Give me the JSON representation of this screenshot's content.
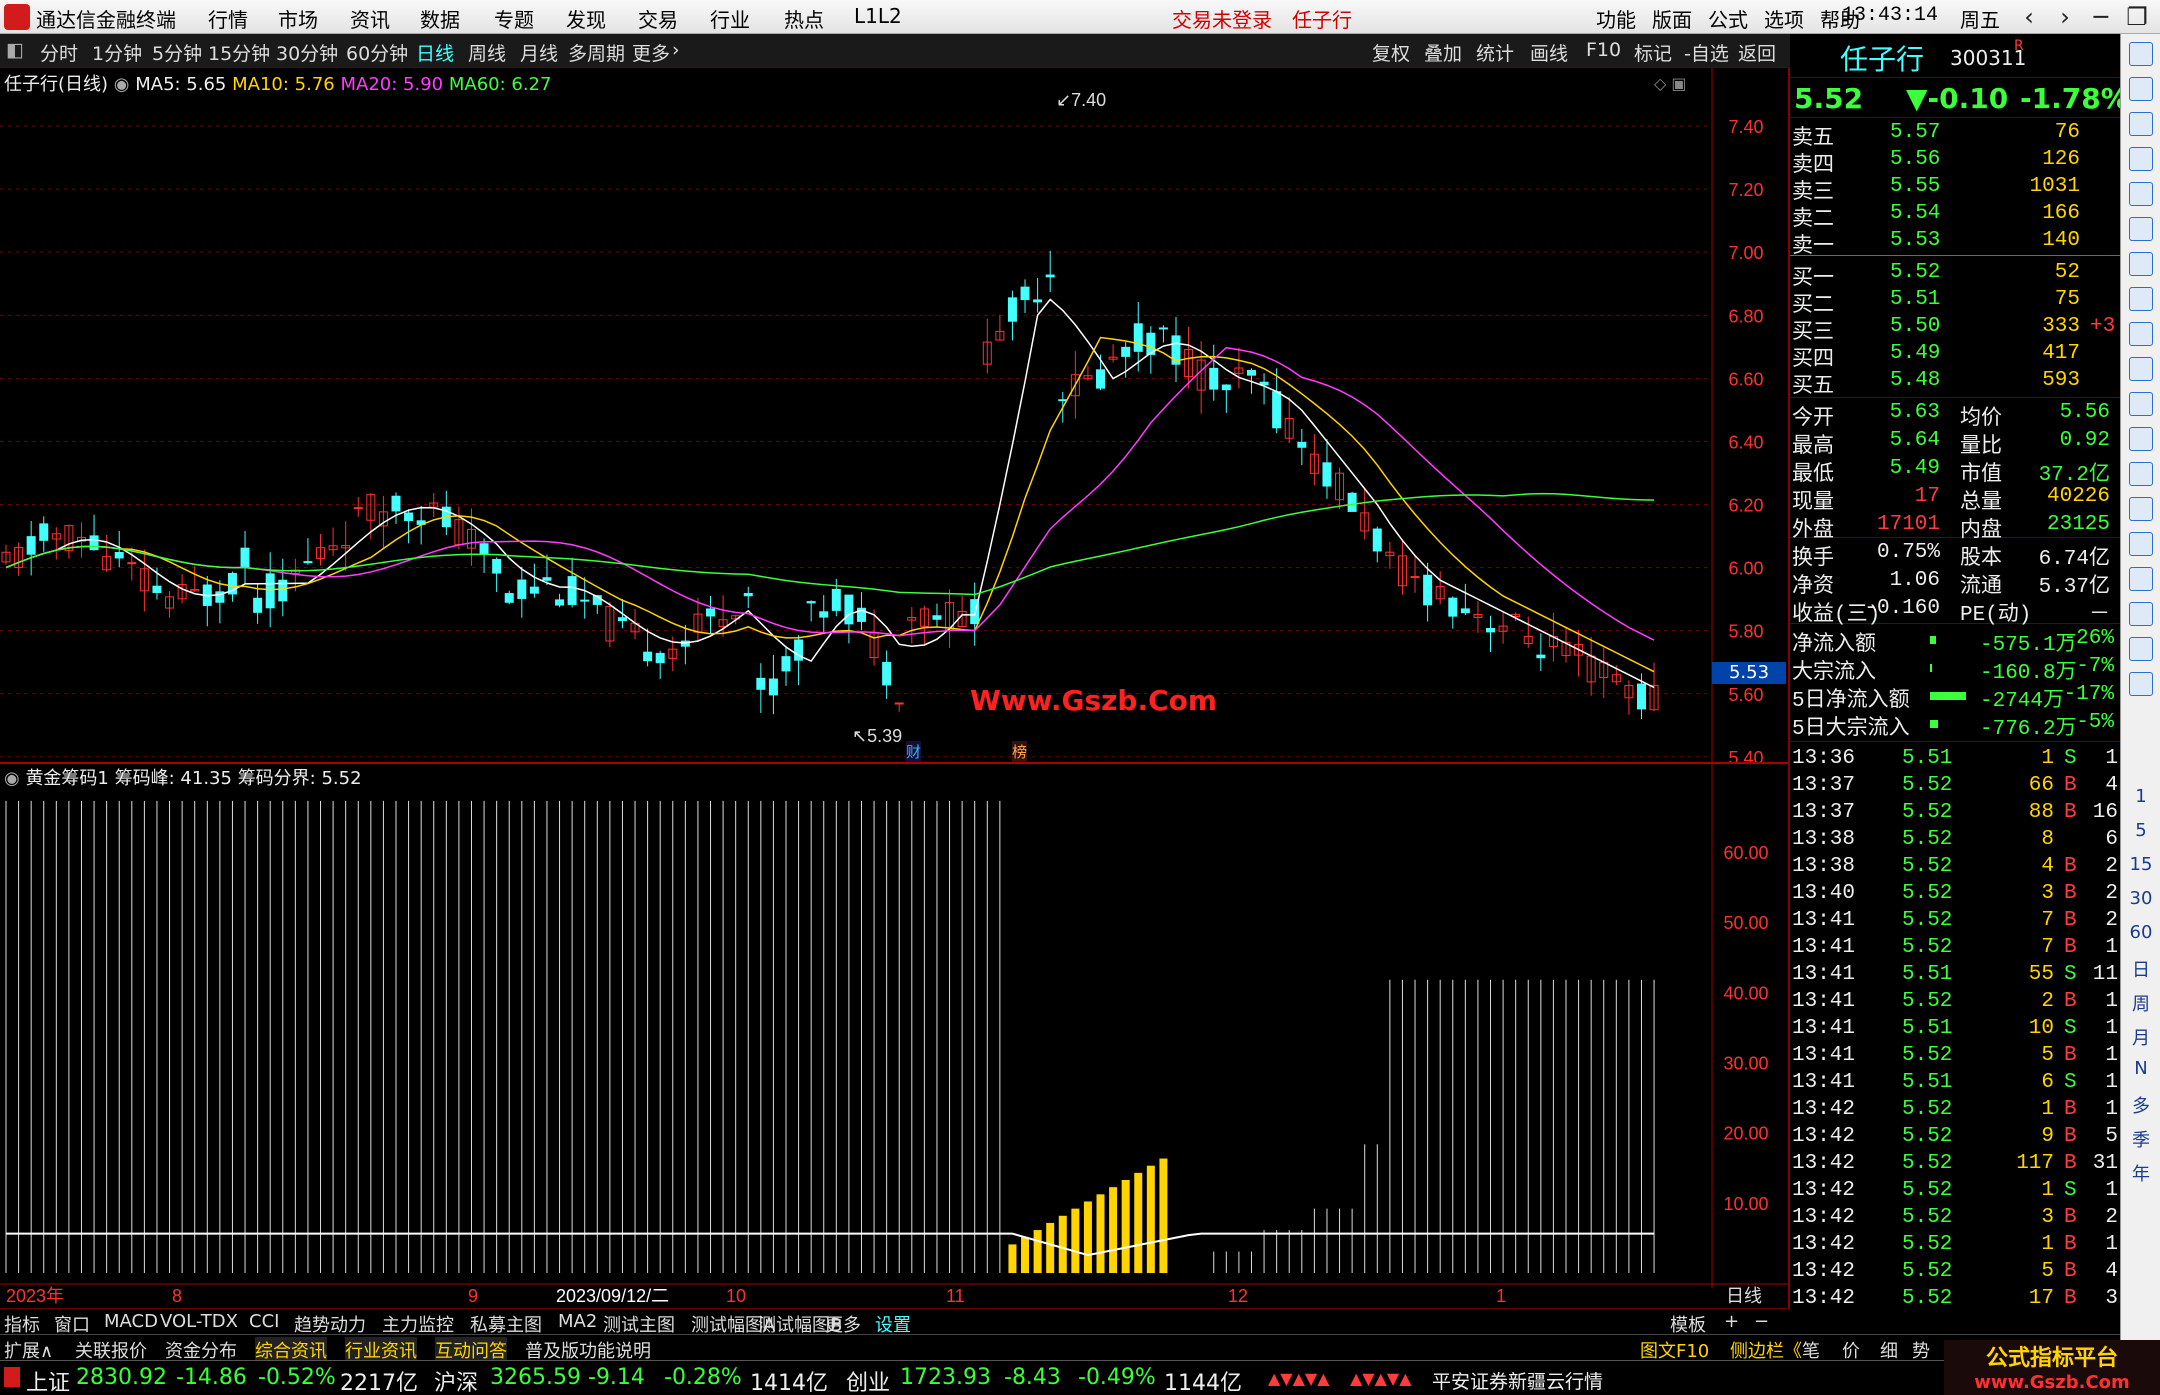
{
  "titlebar": {
    "app": "通达信金融终端",
    "menus": [
      "行情",
      "市场",
      "资讯",
      "数据",
      "专题",
      "发现",
      "交易",
      "行业",
      "热点",
      "L1L2"
    ],
    "login": "交易未登录",
    "stock": "任子行",
    "right_menus": [
      "功能",
      "版面",
      "公式",
      "选项",
      "帮助"
    ],
    "time": "13:43:14",
    "weekday": "周五",
    "controls": [
      "‹",
      "›",
      "─",
      "❐",
      "✕"
    ]
  },
  "periodbar": {
    "items": [
      "分时",
      "1分钟",
      "5分钟",
      "15分钟",
      "30分钟",
      "60分钟",
      "日线",
      "周线",
      "月线",
      "多周期",
      "更多"
    ],
    "active": "日线",
    "tools": [
      "复权",
      "叠加",
      "统计",
      "画线",
      "F10",
      "标记",
      "-自选",
      "返回"
    ]
  },
  "main_chart": {
    "title": "任子行(日线)",
    "ma5": "MA5: 5.65",
    "ma10": "MA10: 5.76",
    "ma20": "MA20: 5.90",
    "ma60": "MA60: 6.27",
    "high_label": "7.40",
    "low_label": "5.39",
    "current_price": "5.53",
    "marker_cai": "财",
    "marker_bang": "榜",
    "watermark": "Www.Gszb.Com",
    "price_ticks": [
      "7.40",
      "7.20",
      "7.00",
      "6.80",
      "6.60",
      "6.40",
      "6.20",
      "6.00",
      "5.80",
      "5.60",
      "5.40"
    ]
  },
  "sub_chart": {
    "title": "黄金筹码1",
    "peak": "筹码峰: 41.35",
    "boundary": "筹码分界: 5.52",
    "ticks": [
      "60.00",
      "50.00",
      "40.00",
      "30.00",
      "20.00",
      "10.00"
    ]
  },
  "xaxis": {
    "labels": [
      "2023年",
      "8",
      "9",
      "2023/09/12/二",
      "10",
      "11",
      "12",
      "1"
    ],
    "right": "日线"
  },
  "chart_data": {
    "type": "candlestick",
    "series": [
      {
        "name": "MA5",
        "value": 5.65
      },
      {
        "name": "MA10",
        "value": 5.76
      },
      {
        "name": "MA20",
        "value": 5.9
      },
      {
        "name": "MA60",
        "value": 6.27
      }
    ],
    "ylim": [
      5.35,
      7.45
    ],
    "high": 7.4,
    "low": 5.39,
    "last": 5.53
  },
  "quote": {
    "name": "任子行",
    "code": "300311",
    "flag": "R",
    "price": "5.52",
    "change": "▼-0.10",
    "pct": "-1.78%",
    "asks": [
      {
        "l": "卖五",
        "p": "5.57",
        "v": "76"
      },
      {
        "l": "卖四",
        "p": "5.56",
        "v": "126"
      },
      {
        "l": "卖三",
        "p": "5.55",
        "v": "1031"
      },
      {
        "l": "卖二",
        "p": "5.54",
        "v": "166"
      },
      {
        "l": "卖一",
        "p": "5.53",
        "v": "140"
      }
    ],
    "bids": [
      {
        "l": "买一",
        "p": "5.52",
        "v": "52",
        "x": ""
      },
      {
        "l": "买二",
        "p": "5.51",
        "v": "75",
        "x": ""
      },
      {
        "l": "买三",
        "p": "5.50",
        "v": "333",
        "x": "+3"
      },
      {
        "l": "买四",
        "p": "5.49",
        "v": "417",
        "x": ""
      },
      {
        "l": "买五",
        "p": "5.48",
        "v": "593",
        "x": ""
      }
    ],
    "stats": [
      {
        "a": "今开",
        "b": "5.63",
        "c": "均价",
        "d": "5.56"
      },
      {
        "a": "最高",
        "b": "5.64",
        "c": "量比",
        "d": "0.92"
      },
      {
        "a": "最低",
        "b": "5.49",
        "c": "市值",
        "d": "37.2亿"
      },
      {
        "a": "现量",
        "b": "17",
        "c": "总量",
        "d": "40226"
      },
      {
        "a": "外盘",
        "b": "17101",
        "c": "内盘",
        "d": "23125"
      }
    ],
    "stats2": [
      {
        "a": "换手",
        "b": "0.75%",
        "c": "股本",
        "d": "6.74亿"
      },
      {
        "a": "净资",
        "b": "1.06",
        "c": "流通",
        "d": "5.37亿"
      },
      {
        "a": "收益(三)",
        "b": "-0.160",
        "c": "PE(动)",
        "d": "－"
      }
    ],
    "flows": [
      {
        "a": "净流入额",
        "b": "-575.1万",
        "c": "-26%"
      },
      {
        "a": "大宗流入",
        "b": "-160.8万",
        "c": "-7%"
      },
      {
        "a": "5日净流入额",
        "b": "-2744万",
        "c": "-17%"
      },
      {
        "a": "5日大宗流入",
        "b": "-776.2万",
        "c": "-5%"
      }
    ],
    "ticks": [
      [
        "13:36",
        "5.51",
        "1",
        "S",
        "1"
      ],
      [
        "13:37",
        "5.52",
        "66",
        "B",
        "4"
      ],
      [
        "13:37",
        "5.52",
        "88",
        "B",
        "16"
      ],
      [
        "13:38",
        "5.52",
        "8",
        "",
        "6"
      ],
      [
        "13:38",
        "5.52",
        "4",
        "B",
        "2"
      ],
      [
        "13:40",
        "5.52",
        "3",
        "B",
        "2"
      ],
      [
        "13:41",
        "5.52",
        "7",
        "B",
        "2"
      ],
      [
        "13:41",
        "5.52",
        "7",
        "B",
        "1"
      ],
      [
        "13:41",
        "5.51",
        "55",
        "S",
        "11"
      ],
      [
        "13:41",
        "5.52",
        "2",
        "B",
        "1"
      ],
      [
        "13:41",
        "5.51",
        "10",
        "S",
        "1"
      ],
      [
        "13:41",
        "5.52",
        "5",
        "B",
        "1"
      ],
      [
        "13:41",
        "5.51",
        "6",
        "S",
        "1"
      ],
      [
        "13:42",
        "5.52",
        "1",
        "B",
        "1"
      ],
      [
        "13:42",
        "5.52",
        "9",
        "B",
        "5"
      ],
      [
        "13:42",
        "5.52",
        "117",
        "B",
        "31"
      ],
      [
        "13:42",
        "5.52",
        "1",
        "S",
        "1"
      ],
      [
        "13:42",
        "5.52",
        "3",
        "B",
        "2"
      ],
      [
        "13:42",
        "5.52",
        "1",
        "B",
        "1"
      ],
      [
        "13:42",
        "5.52",
        "5",
        "B",
        "4"
      ],
      [
        "13:42",
        "5.52",
        "17",
        "B",
        "3"
      ]
    ]
  },
  "bottomtabs": [
    "指标",
    "窗口",
    "MACD",
    "VOL-TDX",
    "CCI",
    "趋势动力",
    "主力监控",
    "私募主图",
    "MA2",
    "测试主图",
    "测试幅图A",
    "测试幅图B",
    "更多",
    "设置"
  ],
  "bottomtabs_right": [
    "模板",
    "+",
    "−"
  ],
  "bottomtabs2": [
    "扩展∧",
    "关联报价",
    "资金分布",
    "综合资讯",
    "行业资讯",
    "互动问答",
    "普及版功能说明"
  ],
  "bottomtabs2_right": [
    "图文F10",
    "侧边栏《",
    "笔",
    "价",
    "细",
    "势"
  ],
  "status": {
    "sh_name": "上证",
    "sh": "2830.92",
    "sh_chg": "-14.86",
    "sh_pct": "-0.52%",
    "sh_amt": "2217亿",
    "hs_name": "沪深",
    "hs": "3265.59",
    "hs_chg": "-9.14",
    "hs_pct": "-0.28%",
    "hs_amt": "1414亿",
    "cy_name": "创业",
    "cy": "1723.93",
    "cy_chg": "-8.43",
    "cy_pct": "-0.49%",
    "cy_amt": "1144亿",
    "broker": "平安证券新疆云行情",
    "brand1": "公式指标平台",
    "brand2": "www.Gszb.Com"
  },
  "sidebar": {
    "labels": [
      "1",
      "5",
      "15",
      "30",
      "60",
      "日",
      "周",
      "月",
      "N",
      "多",
      "季",
      "年"
    ]
  }
}
